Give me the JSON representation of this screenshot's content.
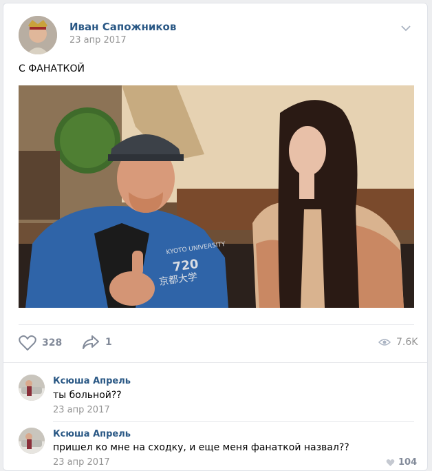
{
  "post": {
    "author": "Иван Сапожников",
    "date": "23 апр 2017",
    "text": "С ФАНАТКОЙ",
    "likes": "328",
    "shares": "1",
    "views": "7.6K"
  },
  "comments": [
    {
      "author": "Ксюша Апрель",
      "text": "ты больной??",
      "date": "23 апр 2017",
      "likes": ""
    },
    {
      "author": "Ксюша Апрель",
      "text": "пришел ко мне на сходку, и еще меня фанаткой назвал??",
      "date": "23 апр 2017",
      "likes": "104"
    }
  ],
  "photo": {
    "hoodie_text": "KYOTO UNIVERSITY 720 京都大学"
  },
  "colors": {
    "link": "#2a5885",
    "muted": "#939393",
    "icon": "#828a99",
    "background": "#edeef0"
  },
  "icons": [
    "heart-icon",
    "share-icon",
    "eye-icon",
    "chevron-down-icon"
  ]
}
